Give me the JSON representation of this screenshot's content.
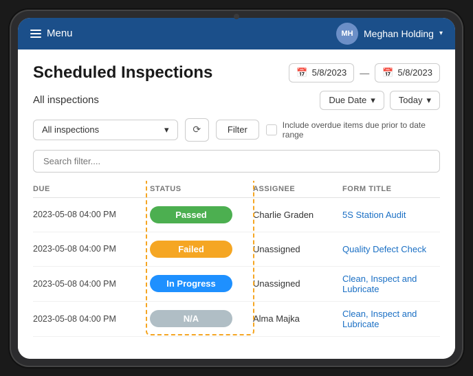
{
  "nav": {
    "menu_label": "Menu",
    "user_name": "Meghan Holding",
    "user_initials": "MH",
    "chevron": "▾"
  },
  "page": {
    "title": "Scheduled Inspections",
    "filter_label": "All inspections",
    "date_from": "5/8/2023",
    "date_to": "5/8/2023",
    "due_date_label": "Due Date",
    "today_label": "Today",
    "inspection_select_label": "All inspections",
    "filter_btn_label": "Filter",
    "overdue_text": "Include overdue items due prior to date range",
    "search_placeholder": "Search filter....",
    "refresh_icon": "⟳"
  },
  "table": {
    "columns": [
      "DUE",
      "STATUS",
      "ASSIGNEE",
      "FORM TITLE"
    ],
    "rows": [
      {
        "due": "2023-05-08 04:00 PM",
        "status": "Passed",
        "status_class": "status-passed",
        "assignee": "Charlie Graden",
        "form_title": "5S Station Audit"
      },
      {
        "due": "2023-05-08 04:00 PM",
        "status": "Failed",
        "status_class": "status-failed",
        "assignee": "Unassigned",
        "form_title": "Quality Defect Check"
      },
      {
        "due": "2023-05-08 04:00 PM",
        "status": "In Progress",
        "status_class": "status-in-progress",
        "assignee": "Unassigned",
        "form_title": "Clean, Inspect and Lubricate"
      },
      {
        "due": "2023-05-08 04:00 PM",
        "status": "N/A",
        "status_class": "status-na",
        "assignee": "Alma Majka",
        "form_title": "Clean, Inspect and Lubricate"
      }
    ]
  }
}
